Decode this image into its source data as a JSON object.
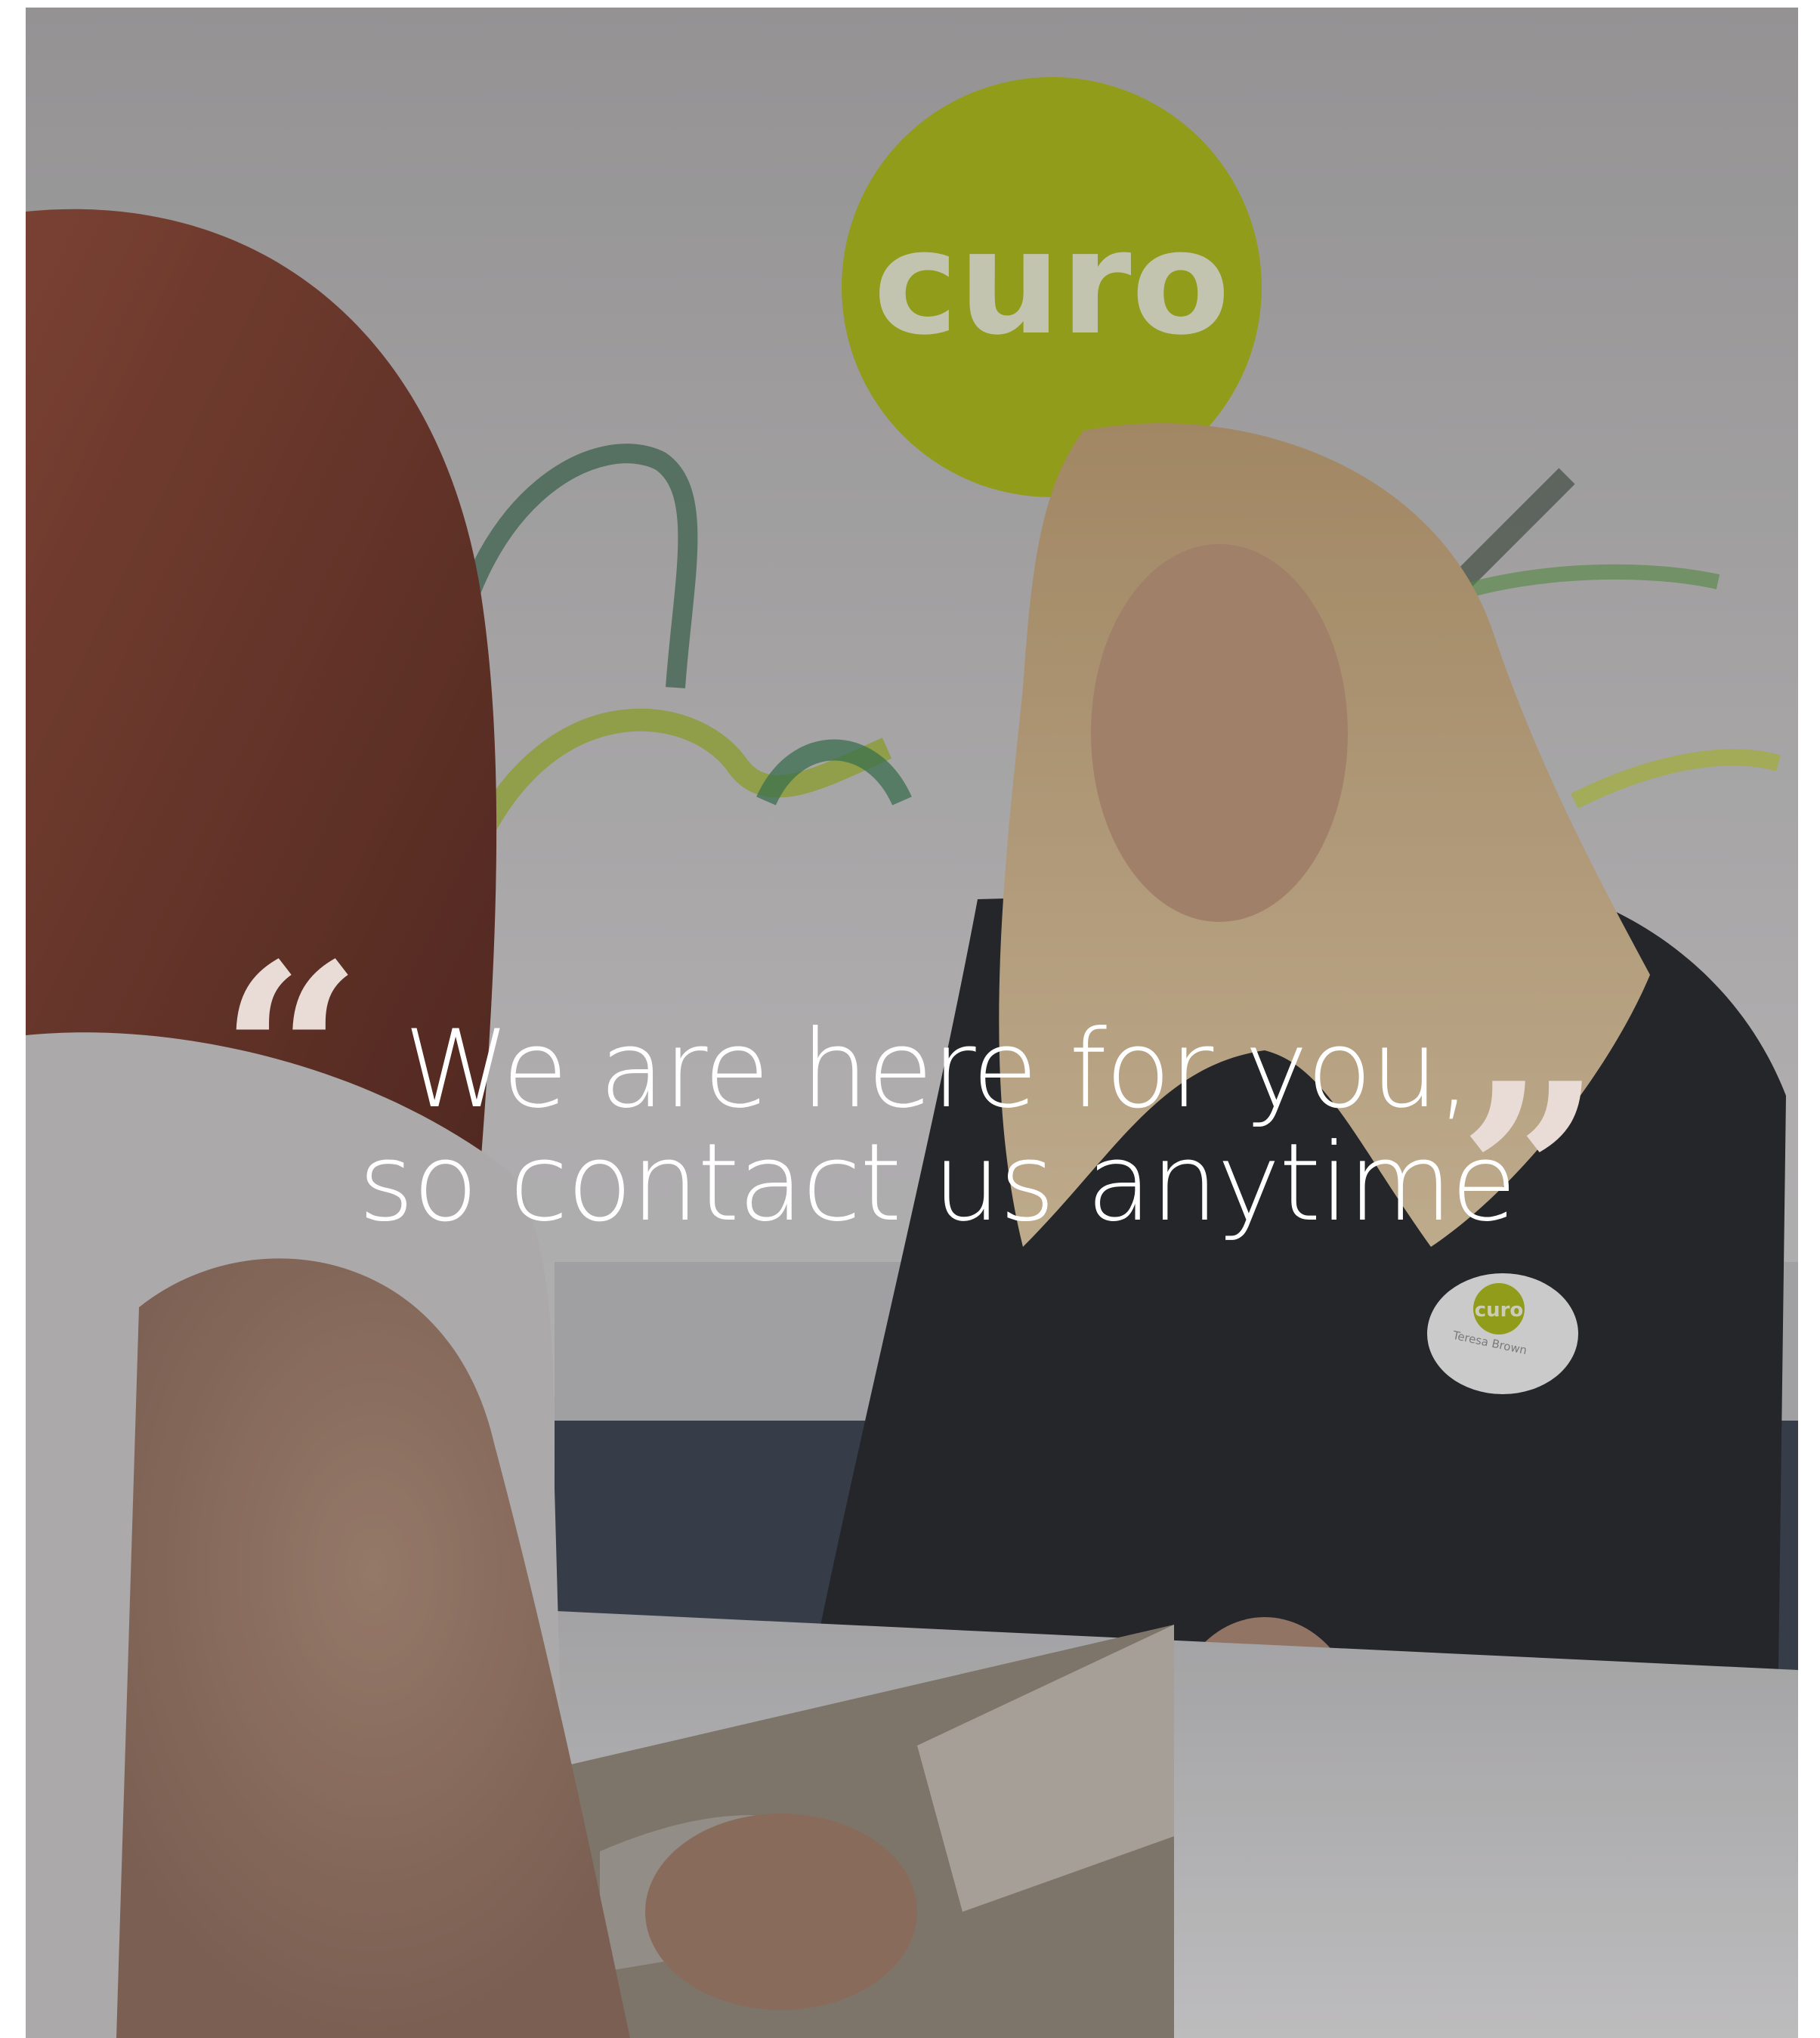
{
  "logo": {
    "text": "curo"
  },
  "badge": {
    "brand": "curo",
    "name": "Teresa Brown"
  },
  "quote": {
    "open_mark": "“",
    "close_mark": "”",
    "line1": "We are here for you,",
    "line2": "so contact us anytime"
  },
  "colors": {
    "brand_lime": "#c5d41f",
    "quote_mark": "#e9dcd6",
    "text": "#ffffff"
  }
}
